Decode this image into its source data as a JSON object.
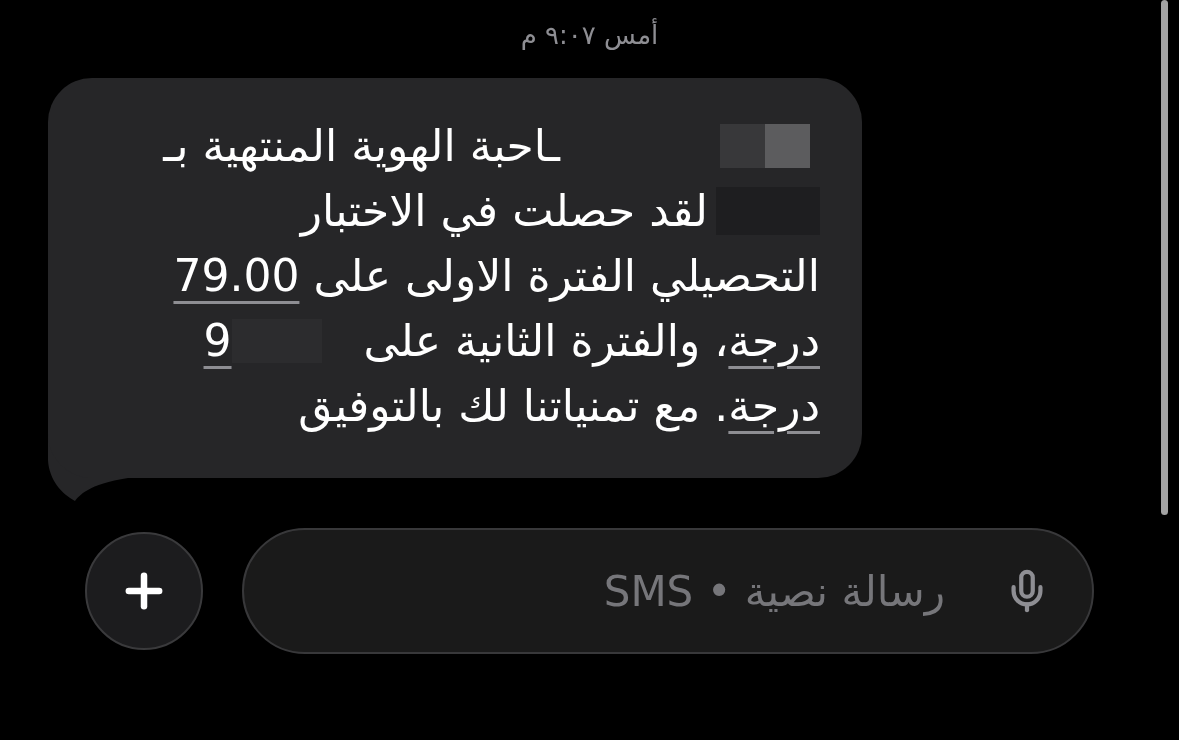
{
  "timestamp": "أمس ٩:٠٧ م",
  "message": {
    "lines": [
      {
        "segments": [
          {
            "kind": "redaction"
          },
          {
            "kind": "text",
            "text": "ـاحبة الهوية المنتهية بـ"
          }
        ]
      },
      {
        "segments": [
          {
            "kind": "redaction"
          },
          {
            "kind": "text",
            "text": "لقد حصلت في الاختبار"
          }
        ]
      },
      {
        "segments": [
          {
            "kind": "text",
            "text": "التحصيلي الفترة الاولى على "
          },
          {
            "kind": "link",
            "text": "79.00"
          }
        ]
      },
      {
        "segments": [
          {
            "kind": "link",
            "text": "درجة"
          },
          {
            "kind": "text",
            "text": "، والفترة الثانية على"
          },
          {
            "kind": "redaction"
          },
          {
            "kind": "link",
            "text": "9"
          }
        ]
      },
      {
        "segments": [
          {
            "kind": "link",
            "text": "درجة"
          },
          {
            "kind": "text",
            "text": ". مع تمنياتنا لك بالتوفيق"
          }
        ]
      }
    ]
  },
  "composer": {
    "placeholder": "رسالة نصية • SMS"
  }
}
